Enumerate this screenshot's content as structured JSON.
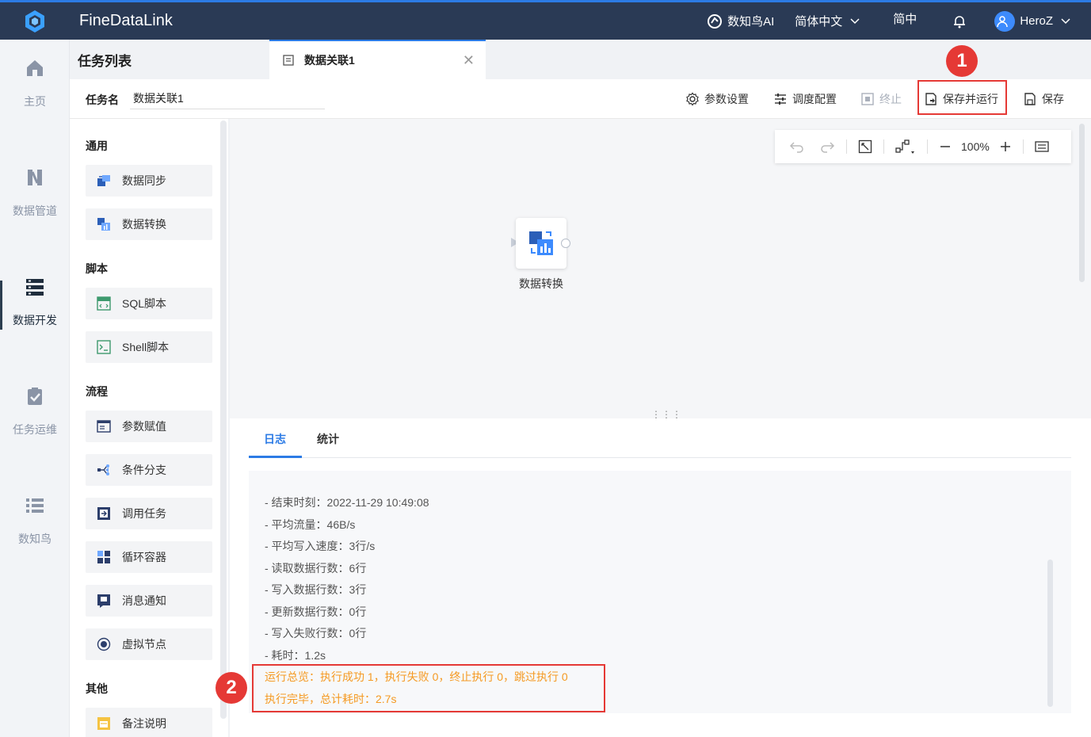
{
  "app": {
    "title": "FineDataLink"
  },
  "header": {
    "ai_label": "数知鸟AI",
    "language": "简体中文",
    "script_toggle": "简中",
    "user": "HeroZ"
  },
  "leftnav": {
    "items": [
      {
        "label": "主页",
        "icon": "home-icon"
      },
      {
        "label": "数据管道",
        "icon": "pipeline-icon"
      },
      {
        "label": "数据开发",
        "icon": "dev-icon",
        "active": true
      },
      {
        "label": "任务运维",
        "icon": "ops-icon"
      },
      {
        "label": "数知鸟",
        "icon": "list-icon"
      }
    ]
  },
  "tasklist": {
    "title": "任务列表"
  },
  "tab": {
    "label": "数据关联1"
  },
  "toolbar": {
    "taskname_label": "任务名",
    "taskname_value": "数据关联1",
    "params_label": "参数设置",
    "schedule_label": "调度配置",
    "stop_label": "终止",
    "save_run_label": "保存并运行",
    "save_label": "保存"
  },
  "markers": {
    "one": "1",
    "two": "2"
  },
  "panel": {
    "groups": [
      {
        "title": "通用",
        "items": [
          "数据同步",
          "数据转换"
        ]
      },
      {
        "title": "脚本",
        "items": [
          "SQL脚本",
          "Shell脚本"
        ]
      },
      {
        "title": "流程",
        "items": [
          "参数赋值",
          "条件分支",
          "调用任务",
          "循环容器",
          "消息通知",
          "虚拟节点"
        ]
      },
      {
        "title": "其他",
        "items": [
          "备注说明"
        ]
      }
    ]
  },
  "canvas": {
    "zoom": "100%",
    "node_label": "数据转换"
  },
  "log": {
    "tabs": [
      "日志",
      "统计"
    ],
    "lines": [
      "- 结束时刻：2022-11-29 10:49:08",
      "- 平均流量：46B/s",
      "- 平均写入速度：3行/s",
      "- 读取数据行数：6行",
      "- 写入数据行数：3行",
      "- 更新数据行数：0行",
      "- 写入失败行数：0行",
      "- 耗时：1.2s"
    ],
    "summary": [
      "运行总览：执行成功 1，执行失败 0，终止执行 0，跳过执行 0",
      "执行完毕，总计耗时：2.7s"
    ],
    "summary_color": "#f59a23"
  }
}
